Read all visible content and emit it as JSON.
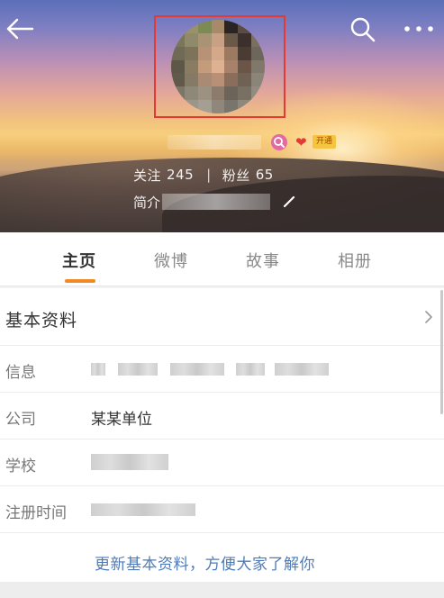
{
  "header": {
    "stats": {
      "following_label": "关注",
      "following_count": "245",
      "separator": "|",
      "followers_label": "粉丝",
      "followers_count": "65"
    },
    "bio_label": "简介",
    "vip_badge": "开通"
  },
  "tabs": [
    {
      "label": "主页",
      "active": true
    },
    {
      "label": "微博",
      "active": false
    },
    {
      "label": "故事",
      "active": false
    },
    {
      "label": "相册",
      "active": false
    }
  ],
  "basic_info": {
    "title": "基本资料",
    "rows": [
      {
        "key": "信息",
        "value": ""
      },
      {
        "key": "公司",
        "value": "某某单位"
      },
      {
        "key": "学校",
        "value": ""
      },
      {
        "key": "注册时间",
        "value": ""
      }
    ],
    "update_link": "更新基本资料，方便大家了解你"
  },
  "colors": {
    "accent_orange": "#f08a24",
    "link_blue": "#4f7bb8",
    "highlight_red": "#e53935"
  },
  "icons": {
    "back": "back-arrow-icon",
    "search": "search-icon",
    "more": "more-icon",
    "edit": "edit-pencil-icon",
    "chevron": "chevron-right-icon"
  }
}
